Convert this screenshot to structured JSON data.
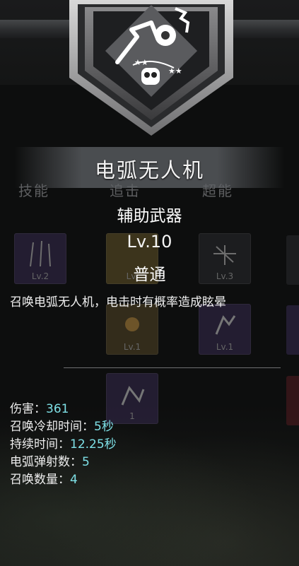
{
  "weapon": {
    "name": "电弧无人机",
    "type": "辅助武器",
    "level": "Lv.10",
    "rarity": "普通",
    "description": "召唤电弧无人机，电击时有概率造成眩晕"
  },
  "background_tabs": [
    "技能",
    "追击",
    "超能"
  ],
  "background_cards": [
    {
      "level": "Lv.2",
      "color": "#3a2c55"
    },
    {
      "level": "Lv.",
      "color": "#6b5a2a"
    },
    {
      "level": "Lv.3",
      "color": "#2c2c30"
    },
    {
      "level": "Lv.1",
      "color": "#5a4a28"
    },
    {
      "level": "Lv.1",
      "color": "#3a2c55"
    },
    {
      "level": "1",
      "color": "#3a2c55"
    }
  ],
  "stats": [
    {
      "label": "伤害：",
      "value": "361"
    },
    {
      "label": "召唤冷却时间：",
      "value": "5秒"
    },
    {
      "label": "持续时间：",
      "value": "12.25秒"
    },
    {
      "label": "电弧弹射数：",
      "value": "5"
    },
    {
      "label": "召唤数量：",
      "value": "4"
    }
  ],
  "colors": {
    "stat_value": "#7ee0e6",
    "epic_card": "#3a2c55",
    "common_card": "#2c2c30"
  },
  "icons": {
    "emblem": "drone-skull-icon"
  }
}
